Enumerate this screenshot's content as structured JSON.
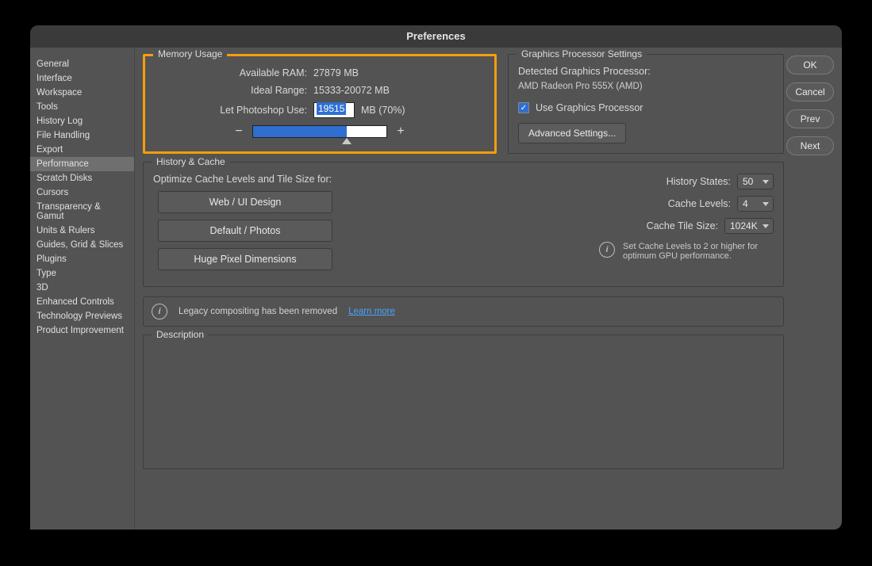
{
  "title": "Preferences",
  "sidebar": {
    "items": [
      {
        "label": "General"
      },
      {
        "label": "Interface"
      },
      {
        "label": "Workspace"
      },
      {
        "label": "Tools"
      },
      {
        "label": "History Log"
      },
      {
        "label": "File Handling"
      },
      {
        "label": "Export"
      },
      {
        "label": "Performance",
        "selected": true
      },
      {
        "label": "Scratch Disks"
      },
      {
        "label": "Cursors"
      },
      {
        "label": "Transparency & Gamut"
      },
      {
        "label": "Units & Rulers"
      },
      {
        "label": "Guides, Grid & Slices"
      },
      {
        "label": "Plugins"
      },
      {
        "label": "Type"
      },
      {
        "label": "3D"
      },
      {
        "label": "Enhanced Controls"
      },
      {
        "label": "Technology Previews"
      },
      {
        "label": "Product Improvement"
      }
    ]
  },
  "buttons": {
    "ok": "OK",
    "cancel": "Cancel",
    "prev": "Prev",
    "next": "Next"
  },
  "memory": {
    "legend": "Memory Usage",
    "available_label": "Available RAM:",
    "available_value": "27879 MB",
    "ideal_label": "Ideal Range:",
    "ideal_value": "15333-20072 MB",
    "let_label": "Let Photoshop Use:",
    "let_value": "19515",
    "let_suffix": "MB (70%)",
    "slider_percent": 70,
    "minus": "−",
    "plus": "+"
  },
  "gpu": {
    "legend": "Graphics Processor Settings",
    "detected_label": "Detected Graphics Processor:",
    "detected_value": "AMD Radeon Pro 555X (AMD)",
    "use_label": "Use Graphics Processor",
    "use_checked": true,
    "adv_button": "Advanced Settings..."
  },
  "history_cache": {
    "legend": "History & Cache",
    "optimize_label": "Optimize Cache Levels and Tile Size for:",
    "presets": [
      "Web / UI Design",
      "Default / Photos",
      "Huge Pixel Dimensions"
    ],
    "history_states_label": "History States:",
    "history_states_value": "50",
    "cache_levels_label": "Cache Levels:",
    "cache_levels_value": "4",
    "cache_tile_label": "Cache Tile Size:",
    "cache_tile_value": "1024K",
    "info_text": "Set Cache Levels to 2 or higher for optimum GPU performance."
  },
  "legacy": {
    "text": "Legacy compositing has been removed",
    "link": "Learn more"
  },
  "description": {
    "legend": "Description"
  }
}
